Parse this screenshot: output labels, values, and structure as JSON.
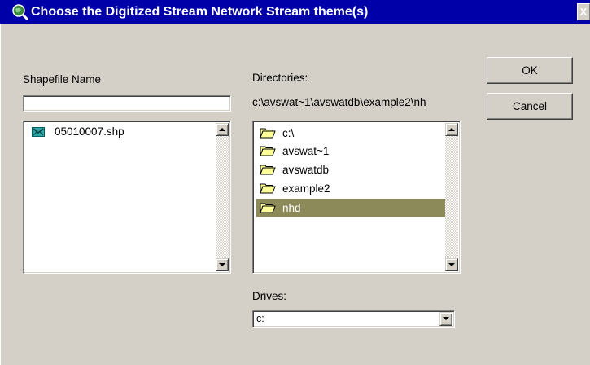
{
  "window": {
    "title": "Choose the Digitized Stream Network Stream theme(s)",
    "close_glyph": "X",
    "title_icon": "globe-magnifier-icon"
  },
  "shapefile": {
    "label": "Shapefile Name",
    "input_value": "",
    "files": [
      {
        "name": "05010007.shp",
        "icon": "shapefile-icon"
      }
    ]
  },
  "directories": {
    "label": "Directories:",
    "current_path": "c:\\avswat~1\\avswatdb\\example2\\nh",
    "items": [
      {
        "name": "c:\\",
        "selected": false
      },
      {
        "name": "avswat~1",
        "selected": false
      },
      {
        "name": "avswatdb",
        "selected": false
      },
      {
        "name": "example2",
        "selected": false
      },
      {
        "name": "nhd",
        "selected": true
      }
    ]
  },
  "drives": {
    "label": "Drives:",
    "selected": "c:"
  },
  "buttons": {
    "ok": "OK",
    "cancel": "Cancel"
  },
  "colors": {
    "titlebar": "#0000a8",
    "face": "#d4d0c8",
    "selection": "#8c8a58"
  }
}
